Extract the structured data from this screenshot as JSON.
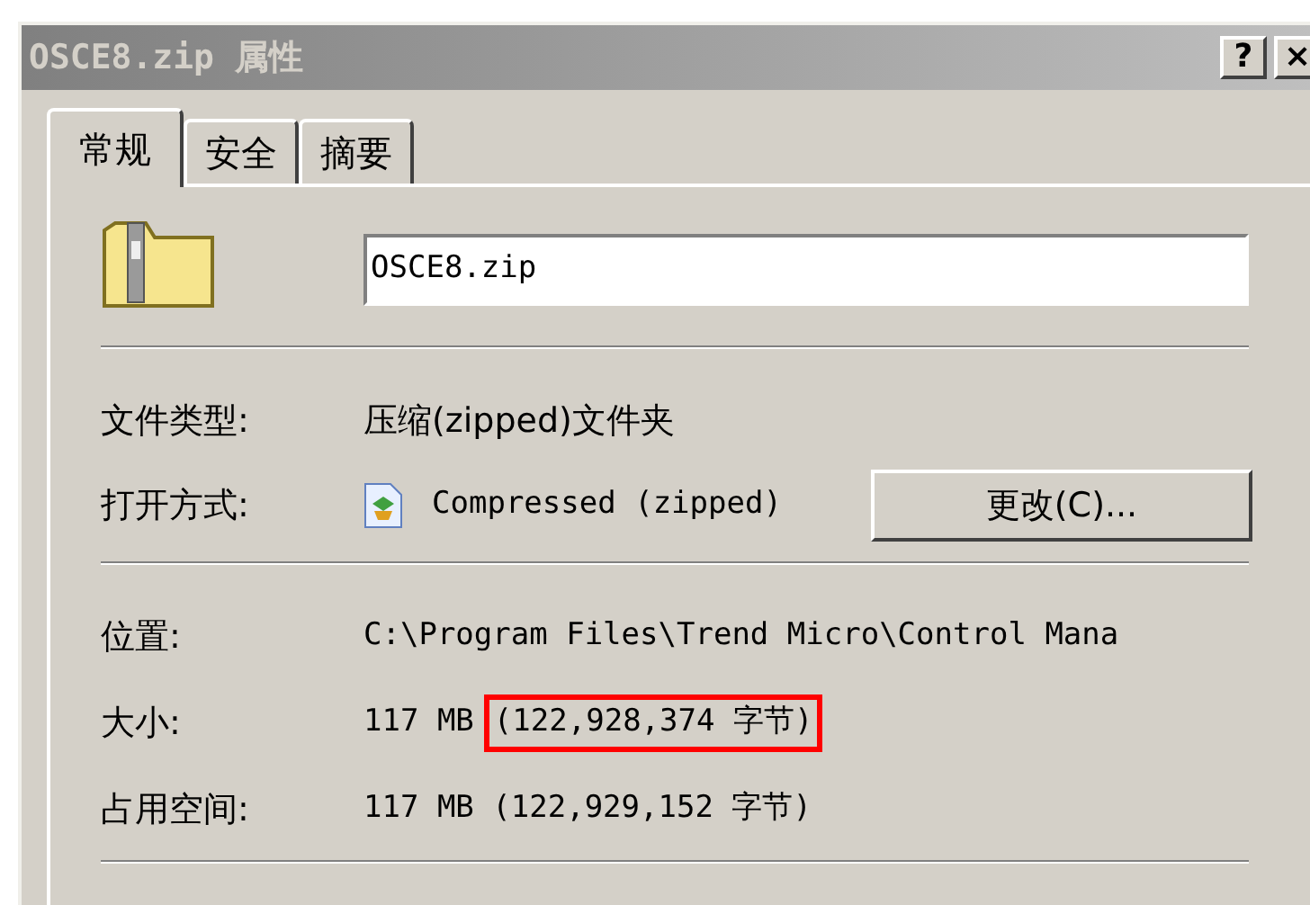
{
  "window": {
    "title": "OSCE8.zip 属性",
    "buttons": [
      "?",
      "×"
    ]
  },
  "tabs": [
    {
      "label": "常规",
      "selected": true
    },
    {
      "label": "安全",
      "selected": false
    },
    {
      "label": "摘要",
      "selected": false
    }
  ],
  "name_field": {
    "value": "OSCE8.zip"
  },
  "type_rows": [
    {
      "label": "文件类型:",
      "value": "压缩(zipped)文件夹"
    }
  ],
  "opens_with": {
    "label": "打开方式:",
    "value": "Compressed (zipped)",
    "button": "更改(C)..."
  },
  "info_rows": [
    {
      "label": "位置:",
      "parts": [
        {
          "text": "C:\\Program Files\\Trend Micro\\Control Mana",
          "highlighted": false
        }
      ]
    },
    {
      "label": "大小:",
      "parts": [
        {
          "text": "117 MB",
          "highlighted": false
        },
        {
          "text": "(122,928,374 字节)",
          "highlighted": true
        }
      ]
    },
    {
      "label": "占用空间:",
      "parts": [
        {
          "text": "117 MB (122,929,152 字节)",
          "highlighted": false
        }
      ]
    }
  ]
}
